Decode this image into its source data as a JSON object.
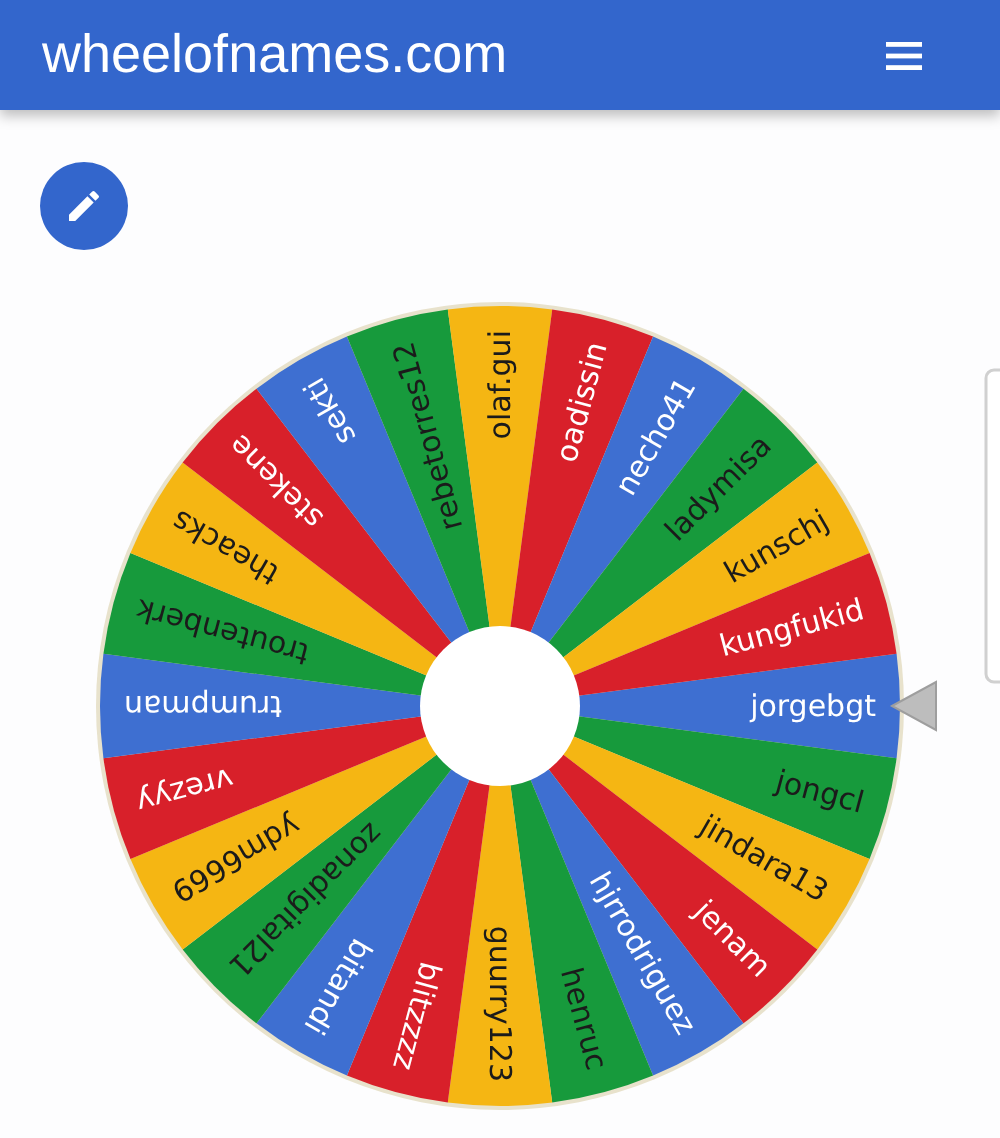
{
  "header": {
    "title": "wheelofnames.com"
  },
  "wheel": {
    "entries": [
      {
        "name": "jorgebgt",
        "color": "#3e6fd1"
      },
      {
        "name": "jongcl",
        "color": "#179a3c"
      },
      {
        "name": "jindara13",
        "color": "#f5b613"
      },
      {
        "name": "jenam",
        "color": "#d8202a"
      },
      {
        "name": "hjrrodriguez",
        "color": "#3e6fd1"
      },
      {
        "name": "henruc",
        "color": "#179a3c"
      },
      {
        "name": "guurry123",
        "color": "#f5b613"
      },
      {
        "name": "blitzzzz",
        "color": "#d8202a"
      },
      {
        "name": "bitandi",
        "color": "#3e6fd1"
      },
      {
        "name": "zonadigital21",
        "color": "#179a3c"
      },
      {
        "name": "ydm6669",
        "color": "#f5b613"
      },
      {
        "name": "vrezyy",
        "color": "#d8202a"
      },
      {
        "name": "trumpman",
        "color": "#3e6fd1"
      },
      {
        "name": "troutenberk",
        "color": "#179a3c"
      },
      {
        "name": "theacks",
        "color": "#f5b613"
      },
      {
        "name": "stekene",
        "color": "#d8202a"
      },
      {
        "name": "sekti",
        "color": "#3e6fd1"
      },
      {
        "name": "rebetorres12",
        "color": "#179a3c"
      },
      {
        "name": "olaf.gui",
        "color": "#f5b613"
      },
      {
        "name": "oadissin",
        "color": "#d8202a"
      },
      {
        "name": "necho41",
        "color": "#3e6fd1"
      },
      {
        "name": "ladymisa",
        "color": "#179a3c"
      },
      {
        "name": "kunschj",
        "color": "#f5b613"
      },
      {
        "name": "kungfukid",
        "color": "#d8202a"
      }
    ]
  }
}
